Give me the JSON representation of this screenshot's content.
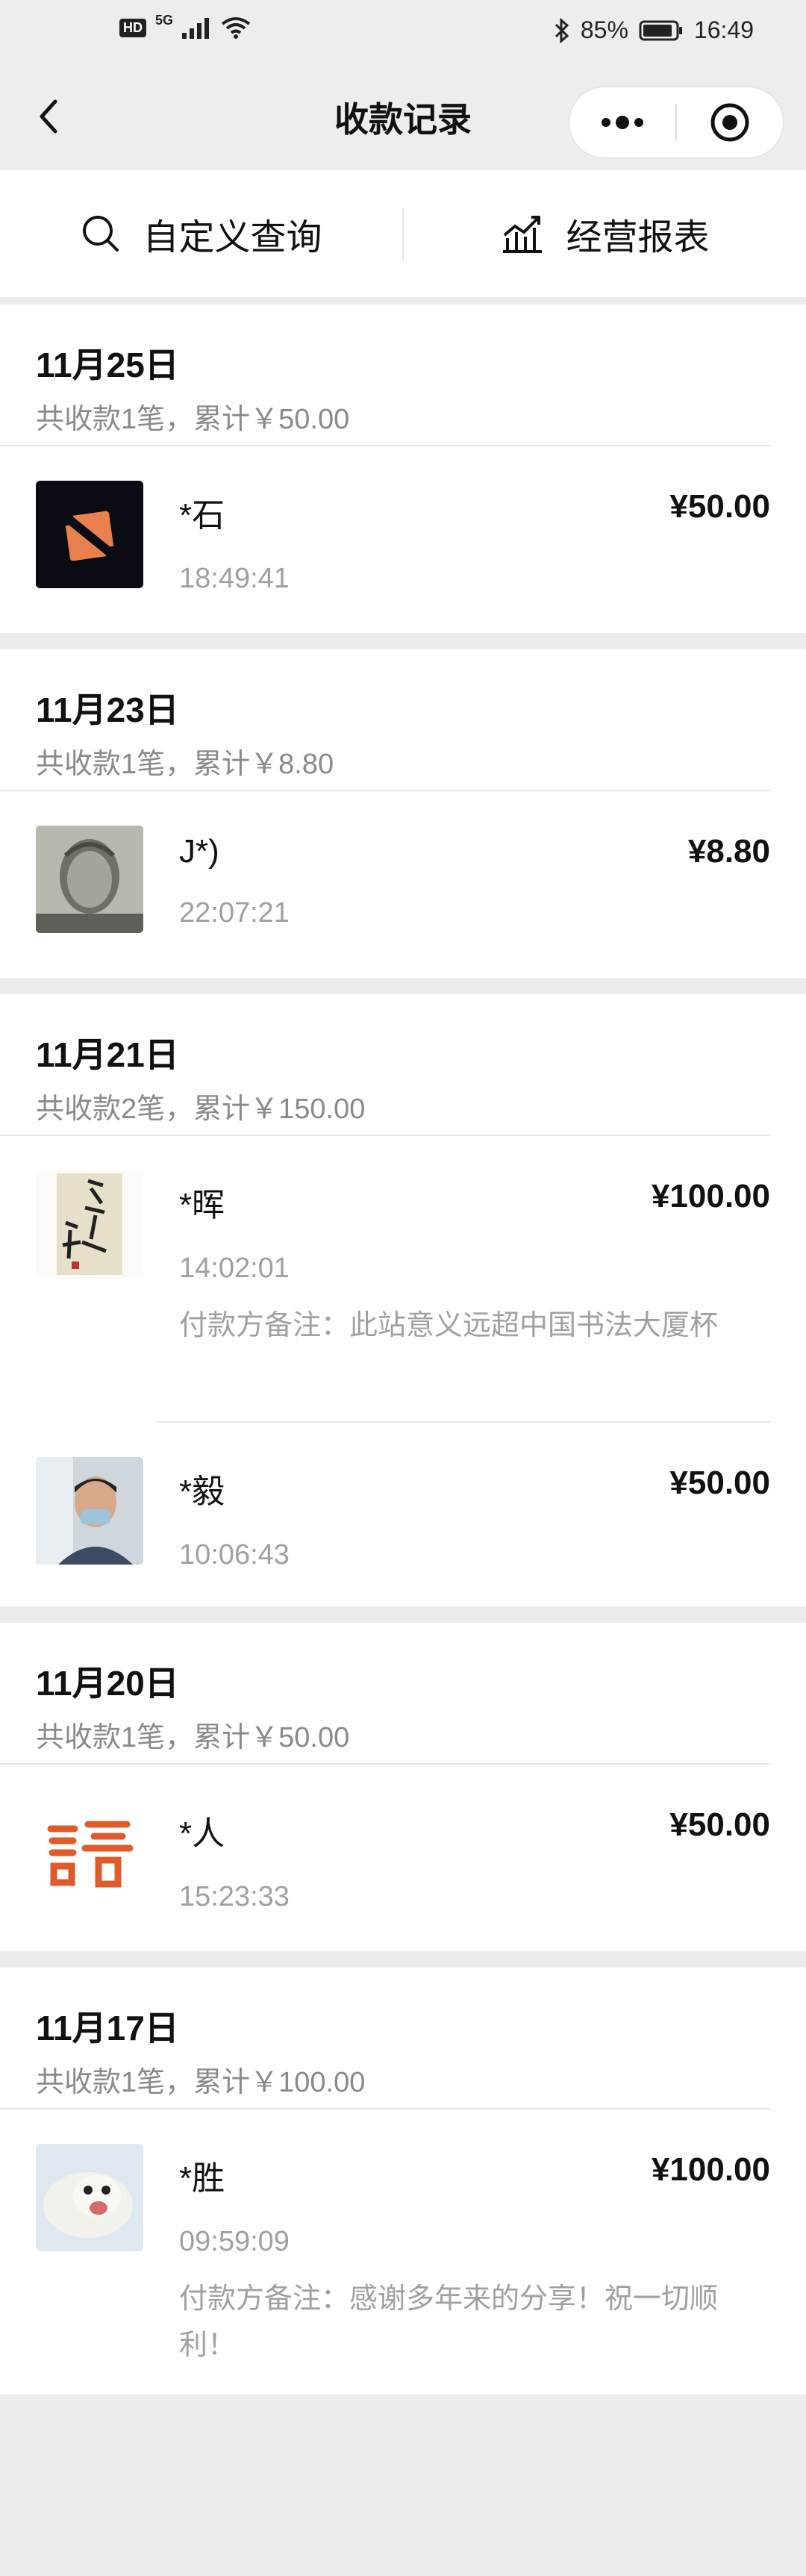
{
  "status_bar": {
    "hd": "HD",
    "network": "5G",
    "battery": "85%",
    "time": "16:49"
  },
  "nav": {
    "title": "收款记录"
  },
  "toolbar": {
    "custom_query": "自定义查询",
    "report": "经营报表"
  },
  "days": [
    {
      "date": "11月25日",
      "summary": "共收款1笔，累计￥50.00",
      "items": [
        {
          "name": "*石",
          "time": "18:49:41",
          "amount": "¥50.00",
          "note": ""
        }
      ]
    },
    {
      "date": "11月23日",
      "summary": "共收款1笔，累计￥8.80",
      "items": [
        {
          "name": "J*)",
          "time": "22:07:21",
          "amount": "¥8.80",
          "note": ""
        }
      ]
    },
    {
      "date": "11月21日",
      "summary": "共收款2笔，累计￥150.00",
      "items": [
        {
          "name": "*晖",
          "time": "14:02:01",
          "amount": "¥100.00",
          "note": "付款方备注：此站意义远超中国书法大厦杯"
        },
        {
          "name": "*毅",
          "time": "10:06:43",
          "amount": "¥50.00",
          "note": ""
        }
      ]
    },
    {
      "date": "11月20日",
      "summary": "共收款1笔，累计￥50.00",
      "items": [
        {
          "name": "*人",
          "time": "15:23:33",
          "amount": "¥50.00",
          "note": ""
        }
      ]
    },
    {
      "date": "11月17日",
      "summary": "共收款1笔，累计￥100.00",
      "items": [
        {
          "name": "*胜",
          "time": "09:59:09",
          "amount": "¥100.00",
          "note": "付款方备注：感谢多年来的分享！祝一切顺利！"
        }
      ]
    }
  ]
}
